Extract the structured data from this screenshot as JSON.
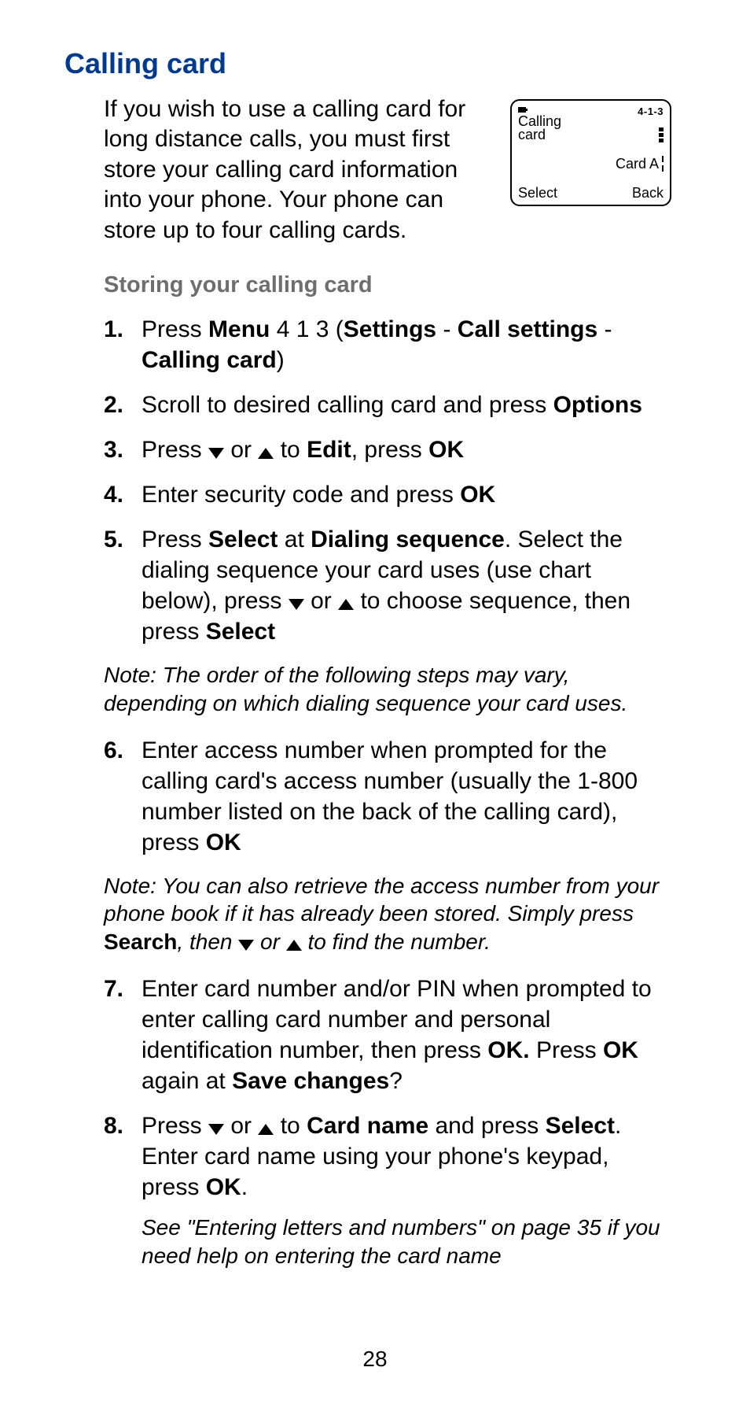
{
  "heading": "Calling card",
  "intro": "If you wish to use a calling card for long distance calls, you must first store your calling card information into your phone. Your phone can store up to four calling cards.",
  "screen": {
    "title_line1": "Calling",
    "title_line2": "card",
    "code": "4-1-3",
    "mid": "Card A",
    "left_soft": "Select",
    "right_soft": "Back"
  },
  "subheading": "Storing your calling card",
  "steps": {
    "s1": {
      "num": "1.",
      "pre": "Press ",
      "b1": "Menu",
      "mid1": " 4 1 3 (",
      "b2": "Settings",
      "mid2": " - ",
      "b3": "Call settings",
      "mid3": " - ",
      "b4": "Calling card",
      "post": ")"
    },
    "s2": {
      "num": "2.",
      "pre": "Scroll to desired calling card and press ",
      "b1": "Options"
    },
    "s3": {
      "num": "3.",
      "pre": "Press ",
      "mid1": " or ",
      "mid2": " to ",
      "b1": "Edit",
      "mid3": ", press ",
      "b2": "OK"
    },
    "s4": {
      "num": "4.",
      "pre": "Enter security code and press ",
      "b1": "OK"
    },
    "s5": {
      "num": "5.",
      "pre": "Press ",
      "b1": "Select",
      "mid1": " at ",
      "b2": "Dialing sequence",
      "mid2": ". Select the dialing sequence your card uses (use chart below), press ",
      "mid3": " or ",
      "mid4": " to choose sequence, then press ",
      "b3": "Select"
    },
    "s6": {
      "num": "6.",
      "pre": "Enter access number when prompted for the calling card's access number (usually the 1-800 number listed on the back of the calling card), press ",
      "b1": "OK"
    },
    "s7": {
      "num": "7.",
      "pre": "Enter card number and/or PIN when prompted to enter calling card number and personal identification number, then press ",
      "b1": "OK.",
      "mid1": " Press ",
      "b2": "OK",
      "mid2": " again at ",
      "b3": "Save changes",
      "post": "?"
    },
    "s8": {
      "num": "8.",
      "pre": "Press ",
      "mid1": " or ",
      "mid2": " to ",
      "b1": "Card name",
      "mid3": " and press ",
      "b2": "Select",
      "mid4": ". Enter card name using your phone's keypad, press ",
      "b3": "OK",
      "post": "."
    }
  },
  "note1": "Note: The order of the following steps may vary, depending on which dialing sequence your card uses.",
  "note2": {
    "pre": "Note: You can also retrieve the access number from your phone book if it has already been stored. Simply press ",
    "b1": "Search",
    "mid1": ", then ",
    "mid2": " or ",
    "post": " to find the number."
  },
  "subnote": "See \"Entering letters and numbers\" on page 35 if you need help on entering the card name",
  "page_num": "28"
}
